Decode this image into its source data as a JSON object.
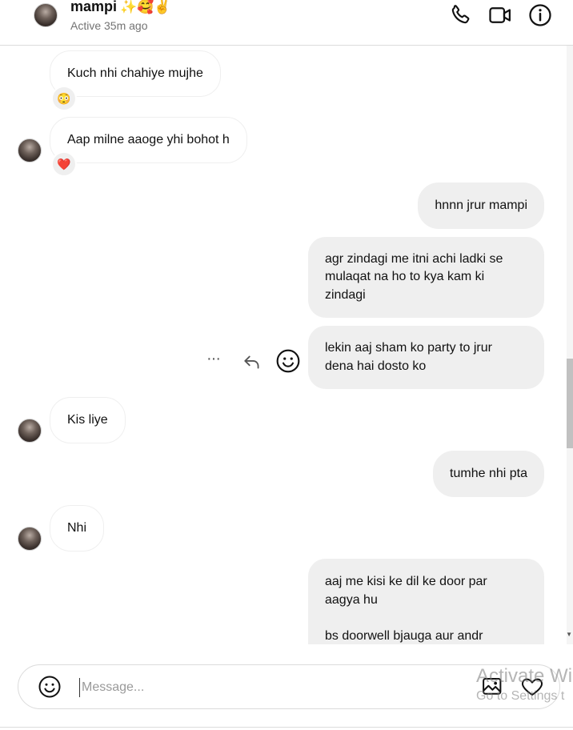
{
  "header": {
    "name": "mampi",
    "name_emojis": "✨🥰✌️",
    "status": "Active 35m ago"
  },
  "messages": {
    "m1": {
      "text": "Kuch nhi chahiye mujhe",
      "reaction": "😳"
    },
    "m2": {
      "text": "Aap milne aaoge yhi bohot h",
      "reaction": "❤️"
    },
    "m3": {
      "text": "hnnn jrur mampi"
    },
    "m4": {
      "text": "agr zindagi me itni achi ladki se\nmulaqat na ho to kya kam ki\nzindagi"
    },
    "m5": {
      "text": "lekin aaj sham ko party to jrur\ndena hai dosto ko"
    },
    "m6": {
      "text": "Kis liye"
    },
    "m7": {
      "text": "tumhe nhi pta"
    },
    "m8": {
      "text": "Nhi"
    },
    "m9": {
      "text": "aaj me kisi ke dil ke door par\naagya hu\n\nbs doorwell bjauga aur andr"
    }
  },
  "message_actions": {
    "more": "···"
  },
  "composer": {
    "placeholder": "Message..."
  },
  "watermark": {
    "line1": "Activate Wi",
    "line2": "Go to Settings t"
  },
  "icons": {
    "call": "phone-icon",
    "video": "video-camera-icon",
    "info": "info-icon",
    "reply": "reply-icon",
    "react": "emoji-icon",
    "image": "image-icon",
    "like": "heart-icon"
  }
}
